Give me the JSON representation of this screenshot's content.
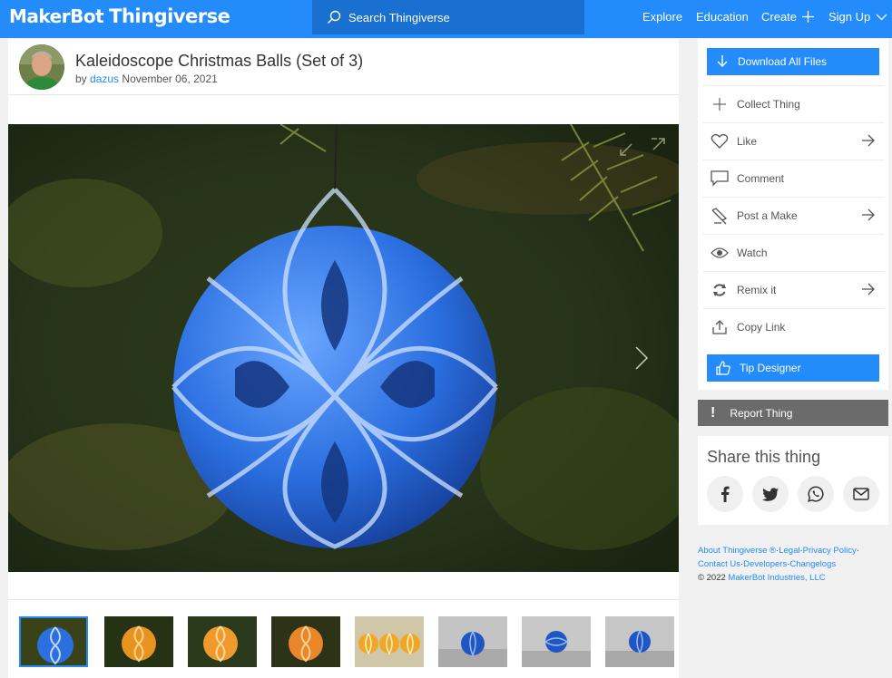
{
  "brand": {
    "maker": "MakerBot",
    "product": "Thingiverse"
  },
  "search": {
    "label": "Search Thingiverse"
  },
  "nav": {
    "explore": "Explore",
    "education": "Education",
    "create": "Create",
    "signup": "Sign Up"
  },
  "thing": {
    "title": "Kaleidoscope Christmas Balls (Set of 3)",
    "by": "by",
    "author": "dazus",
    "date": "November 06, 2021"
  },
  "gallery": {
    "thumb_count": 8,
    "active_index": 0
  },
  "sidebar": {
    "download": "Download All Files",
    "actions": [
      {
        "label": "Collect Thing",
        "icon": "plus-icon"
      },
      {
        "label": "Like",
        "icon": "heart-icon"
      },
      {
        "label": "Comment",
        "icon": "comment-icon"
      },
      {
        "label": "Post a Make",
        "icon": "post-make-icon"
      },
      {
        "label": "Watch",
        "icon": "eye-icon"
      },
      {
        "label": "Remix it",
        "icon": "remix-icon"
      },
      {
        "label": "Copy Link",
        "icon": "share-upload-icon"
      }
    ],
    "tip": "Tip Designer",
    "report": "Report Thing"
  },
  "share": {
    "title": "Share this thing",
    "networks": [
      "facebook-icon",
      "twitter-icon",
      "whatsapp-icon",
      "email-icon"
    ]
  },
  "footer": {
    "about": "About Thingiverse ®",
    "legal": "Legal",
    "privacy": "Privacy Policy",
    "contact": "Contact Us",
    "developers": "Developers",
    "changelogs": "Changelogs",
    "copyright_prefix": "©  2022",
    "company": "MakerBot Industries, LLC"
  },
  "colors": {
    "accent": "#248bfb",
    "report": "#6b6b6b",
    "background": "#f1f1f1"
  }
}
